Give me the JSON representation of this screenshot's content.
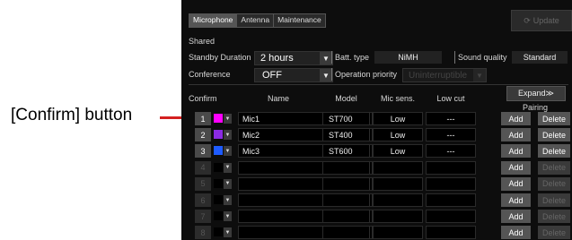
{
  "callout": {
    "label": "[Confirm] button"
  },
  "tabs": [
    {
      "label": "Microphone",
      "active": true
    },
    {
      "label": "Antenna",
      "active": false
    },
    {
      "label": "Maintenance",
      "active": false
    }
  ],
  "update_button": {
    "label": "Update"
  },
  "shared": {
    "heading": "Shared",
    "standby_label": "Standby Duration",
    "standby_value": "2 hours",
    "batt_label": "Batt. type",
    "batt_value": "NiMH",
    "sound_label": "Sound quality",
    "sound_value": "Standard",
    "conference_label": "Conference",
    "conference_value": "OFF",
    "priority_label": "Operation priority",
    "priority_value": "Uninterruptible"
  },
  "table": {
    "headers": {
      "confirm": "Confirm",
      "name": "Name",
      "model": "Model",
      "mic_sens": "Mic sens.",
      "low_cut": "Low cut",
      "pairing": "Pairing"
    },
    "expand_label": "Expand≫",
    "add_label": "Add",
    "delete_label": "Delete",
    "rows": [
      {
        "num": "1",
        "color": "#ff00ff",
        "name": "Mic1",
        "model": "ST700",
        "sens": "Low",
        "lowcut": "---",
        "active": true
      },
      {
        "num": "2",
        "color": "#8a2be2",
        "name": "Mic2",
        "model": "ST400",
        "sens": "Low",
        "lowcut": "---",
        "active": true
      },
      {
        "num": "3",
        "color": "#1e5bff",
        "name": "Mic3",
        "model": "ST600",
        "sens": "Low",
        "lowcut": "---",
        "active": true
      },
      {
        "num": "4",
        "color": "#000000",
        "name": "",
        "model": "",
        "sens": "",
        "lowcut": "",
        "active": false
      },
      {
        "num": "5",
        "color": "#000000",
        "name": "",
        "model": "",
        "sens": "",
        "lowcut": "",
        "active": false
      },
      {
        "num": "6",
        "color": "#000000",
        "name": "",
        "model": "",
        "sens": "",
        "lowcut": "",
        "active": false
      },
      {
        "num": "7",
        "color": "#000000",
        "name": "",
        "model": "",
        "sens": "",
        "lowcut": "",
        "active": false
      },
      {
        "num": "8",
        "color": "#000000",
        "name": "",
        "model": "",
        "sens": "",
        "lowcut": "",
        "active": false
      }
    ]
  }
}
